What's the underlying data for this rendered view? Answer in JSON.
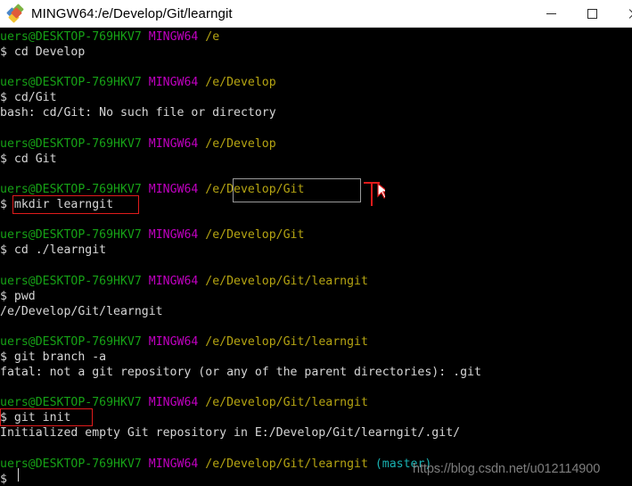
{
  "window": {
    "title": "MINGW64:/e/Develop/Git/learngit",
    "icon": "mingw-diamond-icon",
    "controls": {
      "minimize": "—",
      "maximize": "☐",
      "close": "✕"
    },
    "titlebar_bg": "#ffffff",
    "terminal_bg": "#000000"
  },
  "colors": {
    "user_host": "#16a116",
    "mingw": "#c000c0",
    "path": "#b5a412",
    "branch": "#19b2b2",
    "foreground": "#d6d6d6",
    "highlight_red": "#e01b1b",
    "highlight_gray": "#9a9a9a"
  },
  "terminal": {
    "prompt_user": "uers@DESKTOP-769HKV7",
    "prompt_mingw": "MINGW64",
    "prompt_symbol": "$",
    "lines": [
      {
        "type": "prompt",
        "user": "uers@DESKTOP-769HKV7",
        "mingw": "MINGW64",
        "path": "/e",
        "branch": ""
      },
      {
        "type": "command",
        "text": "cd Develop"
      },
      {
        "type": "blank",
        "text": ""
      },
      {
        "type": "prompt",
        "user": "uers@DESKTOP-769HKV7",
        "mingw": "MINGW64",
        "path": "/e/Develop",
        "branch": ""
      },
      {
        "type": "command",
        "text": "cd/Git"
      },
      {
        "type": "output",
        "text": "bash: cd/Git: No such file or directory"
      },
      {
        "type": "blank",
        "text": ""
      },
      {
        "type": "prompt",
        "user": "uers@DESKTOP-769HKV7",
        "mingw": "MINGW64",
        "path": "/e/Develop",
        "branch": ""
      },
      {
        "type": "command",
        "text": "cd Git"
      },
      {
        "type": "blank",
        "text": ""
      },
      {
        "type": "prompt",
        "user": "uers@DESKTOP-769HKV7",
        "mingw": "MINGW64",
        "path": "/e/Develop/Git",
        "branch": ""
      },
      {
        "type": "command",
        "text": "mkdir learngit"
      },
      {
        "type": "blank",
        "text": ""
      },
      {
        "type": "prompt",
        "user": "uers@DESKTOP-769HKV7",
        "mingw": "MINGW64",
        "path": "/e/Develop/Git",
        "branch": ""
      },
      {
        "type": "command",
        "text": "cd ./learngit"
      },
      {
        "type": "blank",
        "text": ""
      },
      {
        "type": "prompt",
        "user": "uers@DESKTOP-769HKV7",
        "mingw": "MINGW64",
        "path": "/e/Develop/Git/learngit",
        "branch": ""
      },
      {
        "type": "command",
        "text": "pwd"
      },
      {
        "type": "output",
        "text": "/e/Develop/Git/learngit"
      },
      {
        "type": "blank",
        "text": ""
      },
      {
        "type": "prompt",
        "user": "uers@DESKTOP-769HKV7",
        "mingw": "MINGW64",
        "path": "/e/Develop/Git/learngit",
        "branch": ""
      },
      {
        "type": "command",
        "text": "git branch -a"
      },
      {
        "type": "output",
        "text": "fatal: not a git repository (or any of the parent directories): .git"
      },
      {
        "type": "blank",
        "text": ""
      },
      {
        "type": "prompt",
        "user": "uers@DESKTOP-769HKV7",
        "mingw": "MINGW64",
        "path": "/e/Develop/Git/learngit",
        "branch": ""
      },
      {
        "type": "command",
        "text": "git init"
      },
      {
        "type": "output",
        "text": "Initialized empty Git repository in E:/Develop/Git/learngit/.git/"
      },
      {
        "type": "blank",
        "text": ""
      },
      {
        "type": "prompt",
        "user": "uers@DESKTOP-769HKV7",
        "mingw": "MINGW64",
        "path": "/e/Develop/Git/learngit",
        "branch": "(master)"
      },
      {
        "type": "command",
        "text": ""
      }
    ]
  },
  "annotations": {
    "gray_box_label": "/e/Develop/Git",
    "red_box_mkdir_label": "mkdir learngit",
    "red_box_gitinit_label": "$ git init",
    "mouse_cursor": "text-ibeam-cursor"
  },
  "watermark": {
    "text": "https://blog.csdn.net/u012114900"
  }
}
